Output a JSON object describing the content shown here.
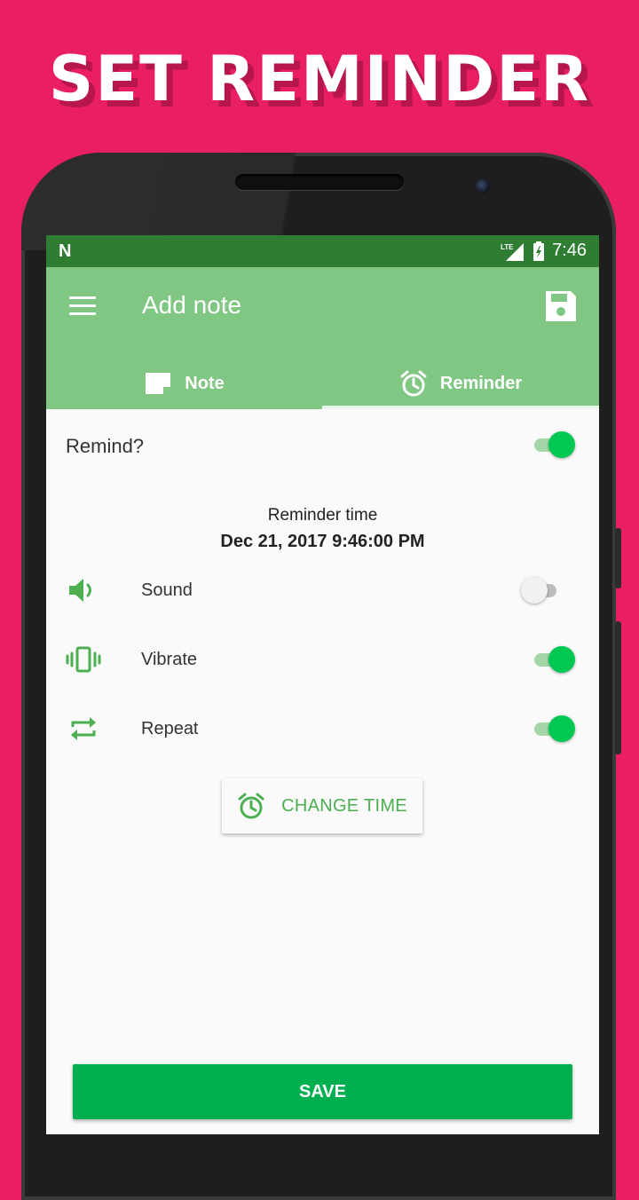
{
  "promo": {
    "title": "SET REMINDER"
  },
  "status_bar": {
    "time": "7:46",
    "network": "LTE",
    "notification": "N"
  },
  "app_bar": {
    "title": "Add note"
  },
  "tabs": [
    {
      "label": "Note",
      "icon": "note-icon",
      "selected": false
    },
    {
      "label": "Reminder",
      "icon": "alarm-clock-icon",
      "selected": true
    }
  ],
  "remind": {
    "label": "Remind?",
    "enabled": true
  },
  "reminder_time": {
    "label": "Reminder time",
    "value": "Dec 21, 2017 9:46:00 PM"
  },
  "options": [
    {
      "label": "Sound",
      "icon": "volume-icon",
      "enabled": false
    },
    {
      "label": "Vibrate",
      "icon": "vibrate-icon",
      "enabled": true
    },
    {
      "label": "Repeat",
      "icon": "repeat-icon",
      "enabled": true
    }
  ],
  "change_time": {
    "label": "CHANGE TIME",
    "icon": "alarm-clock-icon"
  },
  "save": {
    "label": "SAVE"
  },
  "colors": {
    "background": "#e91e63",
    "status_bar": "#2e7d32",
    "app_bar": "#81c784",
    "accent": "#00c853",
    "save_button": "#00b050",
    "icon_green": "#4caf50"
  }
}
